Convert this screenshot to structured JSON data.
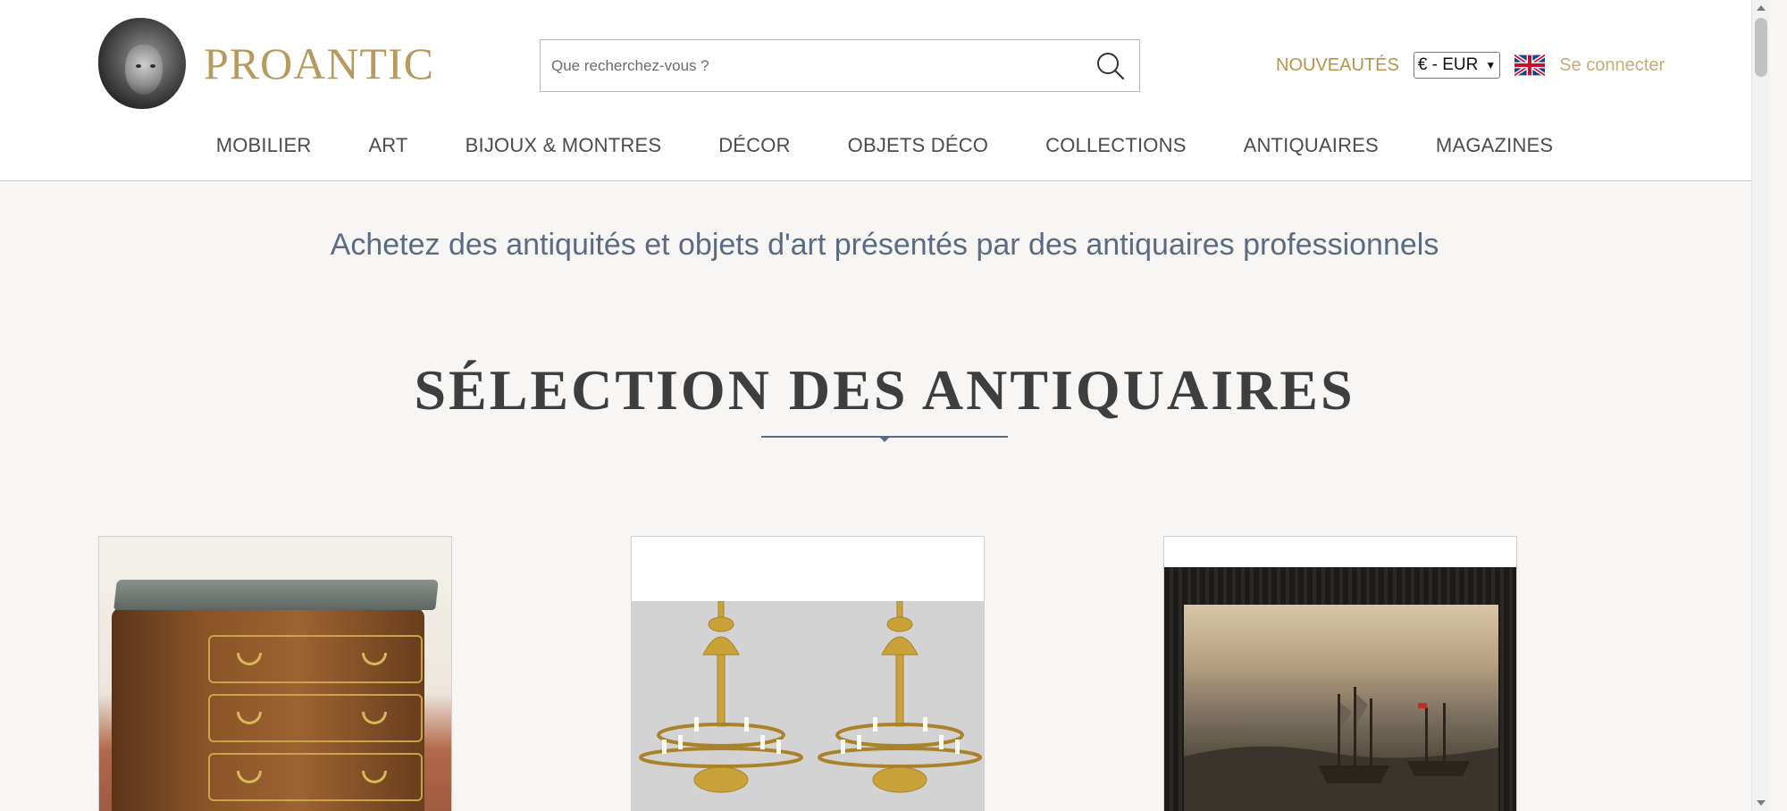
{
  "header": {
    "logo_text": "PROANTIC",
    "search": {
      "placeholder": "Que recherchez-vous ?",
      "value": ""
    },
    "nouveautes_label": "NOUVEAUTÉS",
    "currency": "€ - EUR",
    "language_flag": "uk-flag-icon",
    "login_label": "Se connecter"
  },
  "nav": {
    "items": [
      {
        "label": "MOBILIER"
      },
      {
        "label": "ART"
      },
      {
        "label": "BIJOUX & MONTRES"
      },
      {
        "label": "DÉCOR"
      },
      {
        "label": "OBJETS DÉCO"
      },
      {
        "label": "COLLECTIONS"
      },
      {
        "label": "ANTIQUAIRES"
      },
      {
        "label": "MAGAZINES"
      }
    ]
  },
  "main": {
    "tagline": "Achetez des antiquités et objets d'art présentés par des antiquaires professionnels",
    "section_title": "SÉLECTION DES ANTIQUAIRES"
  },
  "colors": {
    "gold": "#b89a5e",
    "nav_text": "#4b4b4b",
    "tagline": "#5a6b82",
    "background": "#f7f6f4"
  }
}
